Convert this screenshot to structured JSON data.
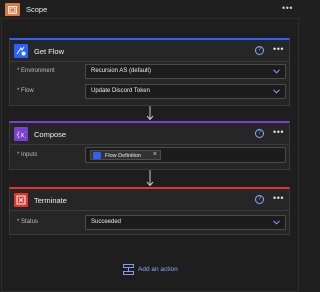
{
  "scope": {
    "title": "Scope",
    "more_icon": "more-icon",
    "accent": "#e3763f"
  },
  "cards": {
    "get_flow": {
      "title": "Get Flow",
      "accent": "#2b61ff",
      "fields": [
        {
          "label": "* Environment",
          "value": "Recursion AS (default)"
        },
        {
          "label": "* Flow",
          "value": "Update Discord Token"
        }
      ]
    },
    "compose": {
      "title": "Compose",
      "accent": "#7a3fcf",
      "inputs_label": "* Inputs",
      "chip_label": "Flow Definition",
      "chip_remove": "×"
    },
    "terminate": {
      "title": "Terminate",
      "accent": "#e5352b",
      "fields": [
        {
          "label": "* Status",
          "value": "Succeeded"
        }
      ]
    }
  },
  "help_glyph": "?",
  "more_glyph": "•••",
  "add_action": {
    "label": "Add an action"
  }
}
